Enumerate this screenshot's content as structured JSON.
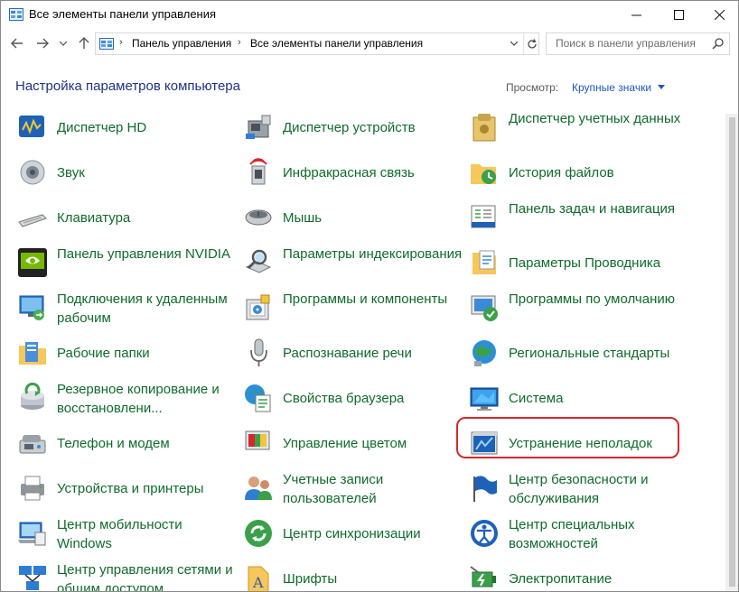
{
  "window": {
    "title": "Все элементы панели управления"
  },
  "address": {
    "crumbs": [
      "Панель управления",
      "Все элементы панели управления"
    ]
  },
  "search": {
    "placeholder": "Поиск в панели управления"
  },
  "header": {
    "title": "Настройка параметров компьютера",
    "view_label": "Просмотр:",
    "view_value": "Крупные значки"
  },
  "columns": [
    {
      "items": [
        {
          "label": "Диспетчер HD",
          "icon": "audio-hd-icon"
        },
        {
          "label": "Звук",
          "icon": "speaker-icon"
        },
        {
          "label": "Клавиатура",
          "icon": "keyboard-icon"
        },
        {
          "label": "Панель управления NVIDIA",
          "icon": "nvidia-icon"
        },
        {
          "label": "Подключения к удаленным рабочим",
          "icon": "remote-desktop-icon"
        },
        {
          "label": "Рабочие папки",
          "icon": "work-folders-icon"
        },
        {
          "label": "Резервное копирование и восстановлени...",
          "icon": "backup-icon"
        },
        {
          "label": "Телефон и модем",
          "icon": "phone-modem-icon"
        },
        {
          "label": "Устройства и принтеры",
          "icon": "printer-icon"
        },
        {
          "label": "Центр мобильности Windows",
          "icon": "mobility-center-icon"
        },
        {
          "label": "Центр управления сетями и общим доступом",
          "icon": "network-center-icon"
        }
      ]
    },
    {
      "items": [
        {
          "label": "Диспетчер устройств",
          "icon": "device-manager-icon"
        },
        {
          "label": "Инфракрасная связь",
          "icon": "infrared-icon"
        },
        {
          "label": "Мышь",
          "icon": "mouse-icon"
        },
        {
          "label": "Параметры индексирования",
          "icon": "indexing-icon"
        },
        {
          "label": "Программы и компоненты",
          "icon": "programs-icon"
        },
        {
          "label": "Распознавание речи",
          "icon": "microphone-icon"
        },
        {
          "label": "Свойства браузера",
          "icon": "internet-options-icon"
        },
        {
          "label": "Управление цветом",
          "icon": "color-management-icon"
        },
        {
          "label": "Учетные записи пользователей",
          "icon": "user-accounts-icon"
        },
        {
          "label": "Центр синхронизации",
          "icon": "sync-center-icon"
        },
        {
          "label": "Шрифты",
          "icon": "fonts-icon"
        }
      ]
    },
    {
      "items": [
        {
          "label": "Диспетчер учетных данных",
          "icon": "credential-manager-icon"
        },
        {
          "label": "История файлов",
          "icon": "file-history-icon"
        },
        {
          "label": "Панель задач и навигация",
          "icon": "taskbar-icon"
        },
        {
          "label": "Параметры Проводника",
          "icon": "explorer-options-icon"
        },
        {
          "label": "Программы по умолчанию",
          "icon": "default-programs-icon"
        },
        {
          "label": "Региональные стандарты",
          "icon": "region-icon"
        },
        {
          "label": "Система",
          "icon": "system-icon"
        },
        {
          "label": "Устранение неполадок",
          "icon": "troubleshooting-icon"
        },
        {
          "label": "Центр безопасности и обслуживания",
          "icon": "security-flag-icon"
        },
        {
          "label": "Центр специальных возможностей",
          "icon": "accessibility-icon"
        },
        {
          "label": "Электропитание",
          "icon": "power-options-icon"
        }
      ]
    }
  ],
  "colors": {
    "link_green": "#0f6b2a",
    "header_blue": "#1e3287",
    "highlight_red": "#d9262b"
  }
}
